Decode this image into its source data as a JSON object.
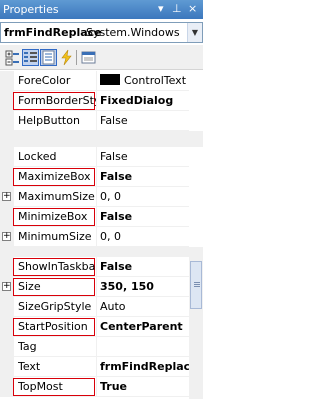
{
  "window": {
    "title": "Properties",
    "controls": {
      "dropdown": "▾",
      "pin": "⊥",
      "close": "×"
    }
  },
  "object_selector": {
    "name": "frmFindReplace",
    "type": "System.Windows"
  },
  "toolbar": {
    "buttons": [
      "categorized-icon",
      "alphabetical-icon",
      "properties-icon",
      "events-icon",
      "property-pages-icon"
    ]
  },
  "sections": [
    {
      "rows": [
        {
          "name": "ForeColor",
          "value": "ControlText",
          "swatch": "#000000",
          "bold": false,
          "highlight": false,
          "expander": false
        },
        {
          "name": "FormBorderStyle",
          "value": "FixedDialog",
          "bold": true,
          "highlight": true,
          "expander": false
        },
        {
          "name": "HelpButton",
          "value": "False",
          "bold": false,
          "highlight": false,
          "expander": false
        }
      ]
    },
    {
      "rows": [
        {
          "name": "Locked",
          "value": "False",
          "bold": false,
          "highlight": false,
          "expander": false
        },
        {
          "name": "MaximizeBox",
          "value": "False",
          "bold": true,
          "highlight": true,
          "expander": false
        },
        {
          "name": "MaximumSize",
          "value": "0, 0",
          "bold": false,
          "highlight": false,
          "expander": true
        },
        {
          "name": "MinimizeBox",
          "value": "False",
          "bold": true,
          "highlight": true,
          "expander": false
        },
        {
          "name": "MinimumSize",
          "value": "0, 0",
          "bold": false,
          "highlight": false,
          "expander": true
        }
      ]
    },
    {
      "rows": [
        {
          "name": "ShowInTaskbar",
          "value": "False",
          "bold": true,
          "highlight": true,
          "expander": false
        },
        {
          "name": "Size",
          "value": "350, 150",
          "bold": true,
          "highlight": true,
          "expander": true
        },
        {
          "name": "SizeGripStyle",
          "value": "Auto",
          "bold": false,
          "highlight": false,
          "expander": false
        },
        {
          "name": "StartPosition",
          "value": "CenterParent",
          "bold": true,
          "highlight": true,
          "expander": false
        },
        {
          "name": "Tag",
          "value": "",
          "bold": false,
          "highlight": false,
          "expander": false
        },
        {
          "name": "Text",
          "value": "frmFindReplace",
          "bold": true,
          "highlight": false,
          "expander": false
        },
        {
          "name": "TopMost",
          "value": "True",
          "bold": true,
          "highlight": true,
          "expander": false
        }
      ]
    }
  ],
  "colors": {
    "title_bar": "#3b77bd",
    "highlight_border": "#d9000a",
    "grid_line": "#f0f0f0"
  }
}
